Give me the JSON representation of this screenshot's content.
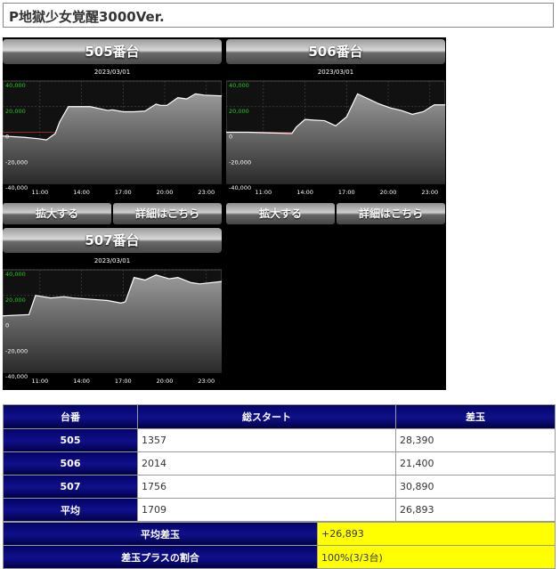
{
  "page_title": "P地獄少女覚醒3000Ver.",
  "charts": [
    {
      "label": "505番台",
      "date": "2023/03/01",
      "detail_label": "詳細はこちら",
      "zoom_label": "拡大する"
    },
    {
      "label": "506番台",
      "date": "2023/03/01",
      "detail_label": "詳細はこちら",
      "zoom_label": "拡大する"
    },
    {
      "label": "507番台",
      "date": "2023/03/01"
    }
  ],
  "chart_data": [
    {
      "type": "area",
      "x_ticks": [
        "11:00",
        "14:00",
        "17:00",
        "20:00",
        "23:00"
      ],
      "y_ticks": [
        "40,000",
        "20,000",
        "0",
        "-20,000",
        "-40,000"
      ],
      "ylim": [
        -40000,
        40000
      ],
      "x": [
        0,
        0.05,
        0.1,
        0.16,
        0.2,
        0.24,
        0.26,
        0.3,
        0.4,
        0.48,
        0.5,
        0.55,
        0.6,
        0.65,
        0.7,
        0.72,
        0.75,
        0.8,
        0.84,
        0.88,
        0.92,
        1.0
      ],
      "values": [
        -3000,
        -3500,
        -4000,
        -5000,
        -6000,
        -1000,
        8000,
        20000,
        20000,
        17000,
        17500,
        16000,
        16000,
        16500,
        22000,
        21000,
        21000,
        27000,
        26000,
        30000,
        29000,
        28390
      ]
    },
    {
      "type": "area",
      "x_ticks": [
        "11:00",
        "14:00",
        "17:00",
        "20:00",
        "23:00"
      ],
      "y_ticks": [
        "40,000",
        "20,000",
        "0",
        "-20,000",
        "-40,000"
      ],
      "ylim": [
        -40000,
        40000
      ],
      "x": [
        0,
        0.1,
        0.2,
        0.3,
        0.32,
        0.36,
        0.4,
        0.45,
        0.5,
        0.55,
        0.6,
        0.65,
        0.7,
        0.75,
        0.8,
        0.85,
        0.9,
        0.95,
        1.0
      ],
      "values": [
        0,
        0,
        -500,
        -1000,
        4000,
        10000,
        9500,
        9000,
        5000,
        12000,
        30000,
        26000,
        22000,
        19000,
        17000,
        14000,
        16000,
        21400,
        21400
      ]
    },
    {
      "type": "area",
      "x_ticks": [
        "11:00",
        "14:00",
        "17:00",
        "20:00",
        "23:00"
      ],
      "y_ticks": [
        "40,000",
        "20,000",
        "0",
        "-20,000",
        "-40,000"
      ],
      "ylim": [
        -40000,
        40000
      ],
      "x": [
        0,
        0.12,
        0.15,
        0.22,
        0.28,
        0.32,
        0.4,
        0.48,
        0.54,
        0.56,
        0.6,
        0.65,
        0.7,
        0.72,
        0.76,
        0.8,
        0.86,
        0.9,
        1.0
      ],
      "values": [
        4000,
        5000,
        20000,
        18000,
        19000,
        18000,
        17000,
        16000,
        14000,
        15000,
        34000,
        32000,
        36000,
        35000,
        33000,
        34000,
        30000,
        29000,
        30890
      ]
    }
  ],
  "table": {
    "headers": [
      "台番",
      "総スタート",
      "差玉"
    ],
    "rows": [
      {
        "label": "505",
        "start": "1357",
        "diff": "28,390"
      },
      {
        "label": "506",
        "start": "2014",
        "diff": "21,400"
      },
      {
        "label": "507",
        "start": "1756",
        "diff": "30,890"
      },
      {
        "label": "平均",
        "start": "1709",
        "diff": "26,893"
      }
    ]
  },
  "summary": {
    "avg_label": "平均差玉",
    "avg_value": "+26,893",
    "ratio_label": "差玉プラスの割合",
    "ratio_value": "100%(3/3台)"
  }
}
